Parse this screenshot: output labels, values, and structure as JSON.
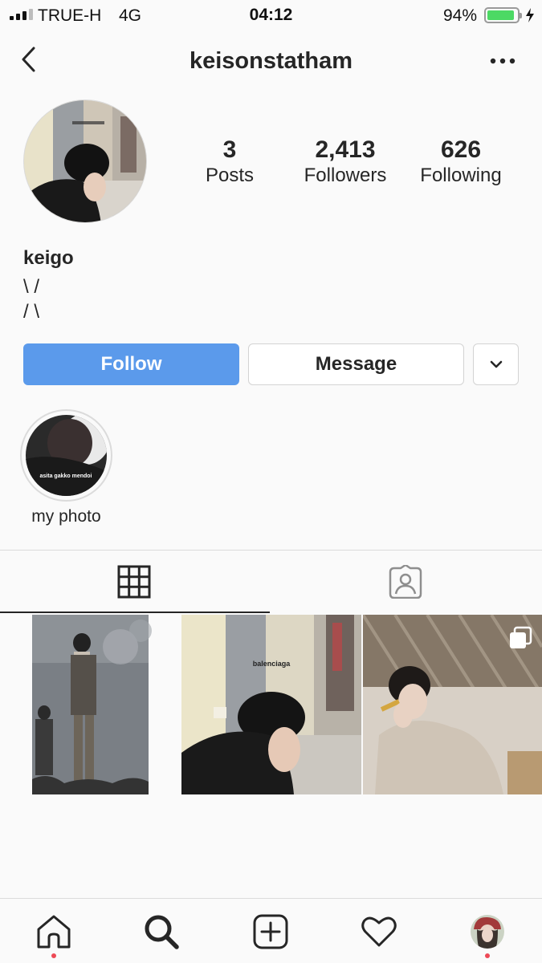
{
  "status_bar": {
    "signal_bars": 4,
    "signal_bars_filled": 3,
    "carrier": "TRUE-H",
    "network": "4G",
    "time": "04:12",
    "battery_percent": "94%",
    "battery_level": 0.94,
    "battery_color": "#4cd964",
    "charging_icon": "bolt-icon"
  },
  "header": {
    "back_icon": "chevron-left-icon",
    "username": "keisonstatham",
    "options_icon": "more-horizontal-icon"
  },
  "profile": {
    "stats": {
      "posts_count": "3",
      "posts_label": "Posts",
      "followers_count": "2,413",
      "followers_label": "Followers",
      "following_count": "626",
      "following_label": "Following"
    },
    "full_name": "keigo",
    "bio": "\\ /\n/ \\",
    "actions": {
      "follow_label": "Follow",
      "message_label": "Message",
      "suggest_icon": "chevron-down-icon"
    },
    "accent_color": "#5b9aeb"
  },
  "highlights": [
    {
      "label": "my photo",
      "cover_text": "asita gakko mendoi"
    }
  ],
  "tabs": [
    {
      "icon": "grid-icon",
      "active": true
    },
    {
      "icon": "tagged-user-icon",
      "active": false
    }
  ],
  "posts": [
    {
      "kind": "photo",
      "caption_text": ""
    },
    {
      "kind": "photo",
      "caption_text": "balenciaga"
    },
    {
      "kind": "carousel",
      "caption_text": ""
    }
  ],
  "bottom_nav": [
    {
      "icon": "home-icon",
      "notification_dot": true
    },
    {
      "icon": "search-icon",
      "notification_dot": false
    },
    {
      "icon": "add-post-icon",
      "notification_dot": false
    },
    {
      "icon": "heart-icon",
      "notification_dot": false
    },
    {
      "icon": "profile-avatar-icon",
      "notification_dot": true
    }
  ],
  "notification_color": "#ed4956"
}
